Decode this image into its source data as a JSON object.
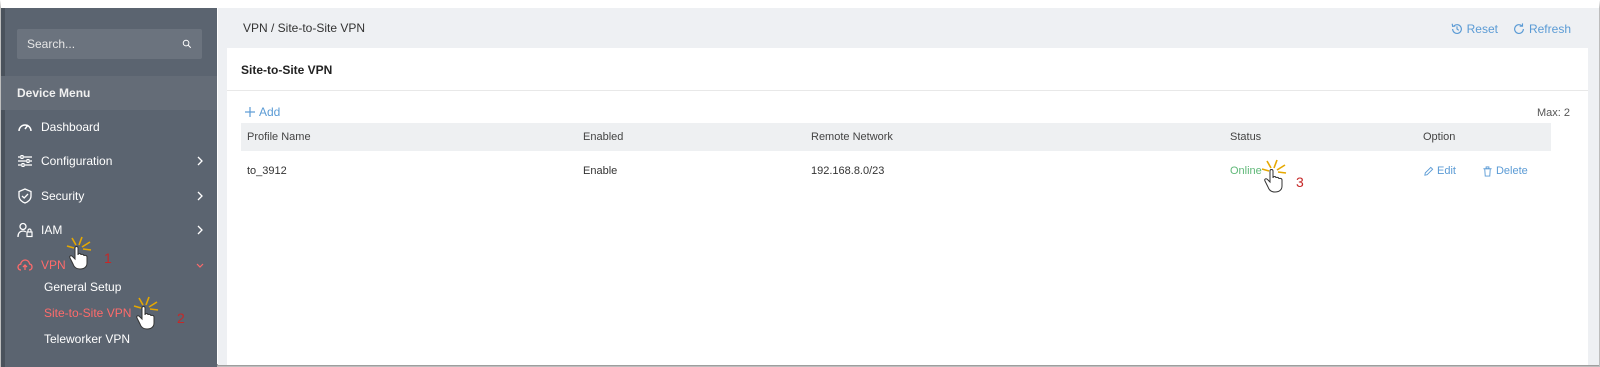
{
  "sidebar": {
    "search_placeholder": "Search...",
    "menu_header": "Device Menu",
    "items": [
      {
        "label": "Dashboard",
        "icon": "dashboard-icon"
      },
      {
        "label": "Configuration",
        "icon": "sliders-icon"
      },
      {
        "label": "Security",
        "icon": "shield-check-icon"
      },
      {
        "label": "IAM",
        "icon": "user-lock-icon"
      },
      {
        "label": "VPN",
        "icon": "cloud-upload-icon"
      }
    ],
    "vpn_subitems": [
      {
        "label": "General Setup"
      },
      {
        "label": "Site-to-Site VPN"
      },
      {
        "label": "Teleworker VPN"
      }
    ]
  },
  "header": {
    "breadcrumb": "VPN / Site-to-Site VPN",
    "reset_label": "Reset",
    "refresh_label": "Refresh"
  },
  "card": {
    "title": "Site-to-Site VPN",
    "add_label": "Add",
    "max_label": "Max: 2"
  },
  "table": {
    "columns": [
      "Profile Name",
      "Enabled",
      "Remote Network",
      "Status",
      "Option"
    ],
    "rows": [
      {
        "profile_name": "to_3912",
        "enabled": "Enable",
        "remote_network": "192.168.8.0/23",
        "status": "Online",
        "edit_label": "Edit",
        "delete_label": "Delete"
      }
    ]
  },
  "annotations": [
    "1",
    "2",
    "3"
  ],
  "colors": {
    "sidebar_bg": "#5b6470",
    "active_red": "#ff6b6b",
    "link_blue": "#5b9bd5",
    "online_green": "#5fb878",
    "annotation_red": "#c62828"
  }
}
